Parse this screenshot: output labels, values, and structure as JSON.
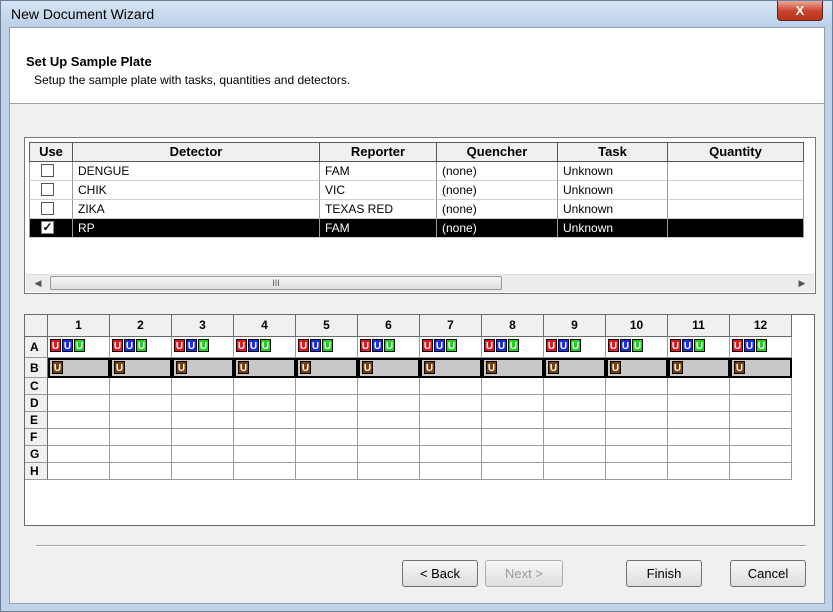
{
  "window": {
    "title": "New Document Wizard",
    "close_glyph": "X"
  },
  "header": {
    "title": "Set Up Sample Plate",
    "subtitle": "Setup the sample plate with tasks, quantities and detectors."
  },
  "detector_table": {
    "columns": [
      "Use",
      "Detector",
      "Reporter",
      "Quencher",
      "Task",
      "Quantity"
    ],
    "rows": [
      {
        "use": false,
        "detector": "DENGUE",
        "reporter": "FAM",
        "quencher": "(none)",
        "task": "Unknown",
        "quantity": ""
      },
      {
        "use": false,
        "detector": "CHIK",
        "reporter": "VIC",
        "quencher": "(none)",
        "task": "Unknown",
        "quantity": ""
      },
      {
        "use": false,
        "detector": "ZIKA",
        "reporter": "TEXAS RED",
        "quencher": "(none)",
        "task": "Unknown",
        "quantity": ""
      },
      {
        "use": true,
        "detector": "RP",
        "reporter": "FAM",
        "quencher": "(none)",
        "task": "Unknown",
        "quantity": "",
        "selected": true
      }
    ],
    "scrollbar": {
      "left_arrow": "◀",
      "right_arrow": "▶",
      "grip": "III"
    }
  },
  "plate": {
    "columns": [
      "1",
      "2",
      "3",
      "4",
      "5",
      "6",
      "7",
      "8",
      "9",
      "10",
      "11",
      "12"
    ],
    "rows": [
      "A",
      "B",
      "C",
      "D",
      "E",
      "F",
      "G",
      "H"
    ],
    "well_label": "U",
    "row_a_colors": [
      "#e8141c",
      "#1c2ce0",
      "#1ed21e"
    ],
    "row_b_color": "#7b3f06",
    "selected_row": "B"
  },
  "buttons": {
    "back": "< Back",
    "next": "Next >",
    "finish": "Finish",
    "cancel": "Cancel"
  }
}
